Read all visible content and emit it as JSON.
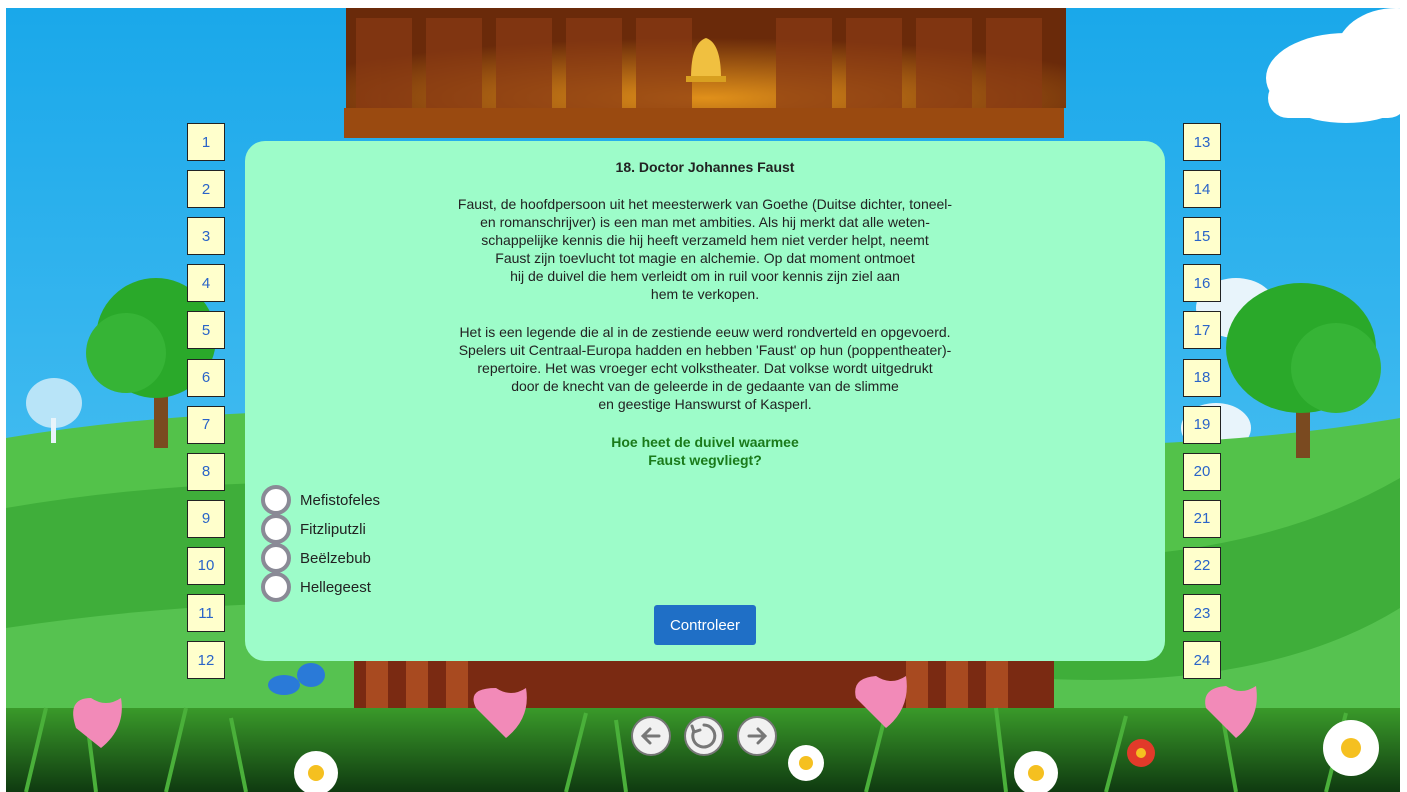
{
  "left_buttons": [
    "1",
    "2",
    "3",
    "4",
    "5",
    "6",
    "7",
    "8",
    "9",
    "10",
    "11",
    "12"
  ],
  "right_buttons": [
    "13",
    "14",
    "15",
    "16",
    "17",
    "18",
    "19",
    "20",
    "21",
    "22",
    "23",
    "24"
  ],
  "card": {
    "title": "18. Doctor Johannes Faust",
    "paragraph1": [
      "Faust, de hoofdpersoon uit het meesterwerk van Goethe (Duitse dichter, toneel-",
      "en romanschrijver) is een man met ambities. Als hij merkt dat alle weten-",
      "schappelijke kennis die hij heeft verzameld hem niet verder helpt, neemt",
      "Faust zijn toevlucht tot magie en alchemie. Op dat moment ontmoet",
      "hij de duivel die hem verleidt om in ruil voor kennis zijn ziel aan",
      "hem te verkopen."
    ],
    "paragraph2": [
      "Het is een legende die al in de zestiende eeuw werd rondverteld en opgevoerd.",
      "Spelers uit Centraal-Europa hadden en hebben 'Faust' op hun (poppentheater)-",
      "repertoire. Het was vroeger echt volkstheater. Dat volkse wordt uitgedrukt",
      "door de knecht van de geleerde in de gedaante van de slimme",
      "en geestige Hanswurst of Kasperl."
    ],
    "question": [
      "Hoe heet de duivel waarmee",
      "Faust wegvliegt?"
    ],
    "options": [
      "Mefistofeles",
      "Fitzliputzli",
      "Beëlzebub",
      "Hellegeest"
    ],
    "check_label": "Controleer"
  },
  "nav": {
    "prev_icon": "arrow-left-icon",
    "reload_icon": "reload-icon",
    "next_icon": "arrow-right-icon"
  },
  "colors": {
    "panel": "#9dfcc9",
    "button_bg": "#ffffcc",
    "button_text": "#2a64c8",
    "question": "#1a7a1a",
    "check_button": "#1f6fc6"
  }
}
